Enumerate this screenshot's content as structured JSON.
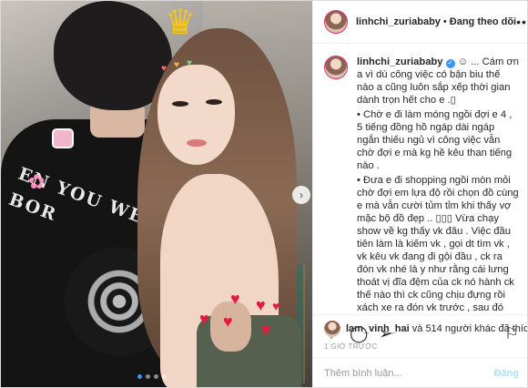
{
  "header": {
    "username": "linhchi_zuriababy",
    "separator": "•",
    "follow_status": "Đang theo dõi",
    "more_icon": "more-horizontal-icon"
  },
  "caption": {
    "username": "linhchi_zuriababy",
    "verified_icon": "verified-badge-icon",
    "lines": [
      "☺ ... Cám ơn a vì dù công việc có bận biu thế nào a cũng luôn sắp xếp thời gian dành trọn hết cho e .▯",
      "• Chờ e đi làm móng ngồi đợi e 4 , 5 tiếng đồng hồ ngáp dài ngáp ngắn thiếu ngủ vì công việc vẫn chờ đợi e mà kg hề kêu than tiếng nào .",
      "• Đưa e đi shopping ngồi mòn mỏi chờ đợi em lựa độ rồi chọn đồ cùng e mà vẫn cười tủm tỉm khi thấy vợ mặc bộ đồ đẹp .. ▯▯▯ Vừa chạy show về kg thấy vk đâu . Việc đầu tiên làm là kiếm vk , gọi dt tìm vk , vk kêu vk đang đi gội đầu , ck ra đón vk nhé là y như rằng cái lưng thoát vị đĩa đệm của ck nó hành ck thế nào thì ck cũng chịu đựng rồi xách xe ra đón vk trước , sau đó mới về ngả lưng ▯"
    ]
  },
  "actions": {
    "like_icon": "heart-outline-icon",
    "comment_icon": "comment-icon",
    "share_icon": "share-icon",
    "save_icon": "bookmark-icon"
  },
  "likes": {
    "first_user": "lam_vinh_hai",
    "rest": "và 514 người khác đã thích"
  },
  "timestamp": "1 GIỜ TRƯỚC",
  "composer": {
    "placeholder": "Thêm bình luận...",
    "post_label": "Đăng"
  },
  "carousel": {
    "next_icon": "chevron-right-icon",
    "dot_count": 4,
    "active_index": 0
  },
  "stickers": {
    "crown_icon": "crown-sticker-icon",
    "heart_icon": "heart-sticker-icon",
    "gift_icon": "gift-sticker-icon",
    "bow_icon": "bow-sticker-icon"
  },
  "shirt_print": "EN YOU WERE BOR"
}
